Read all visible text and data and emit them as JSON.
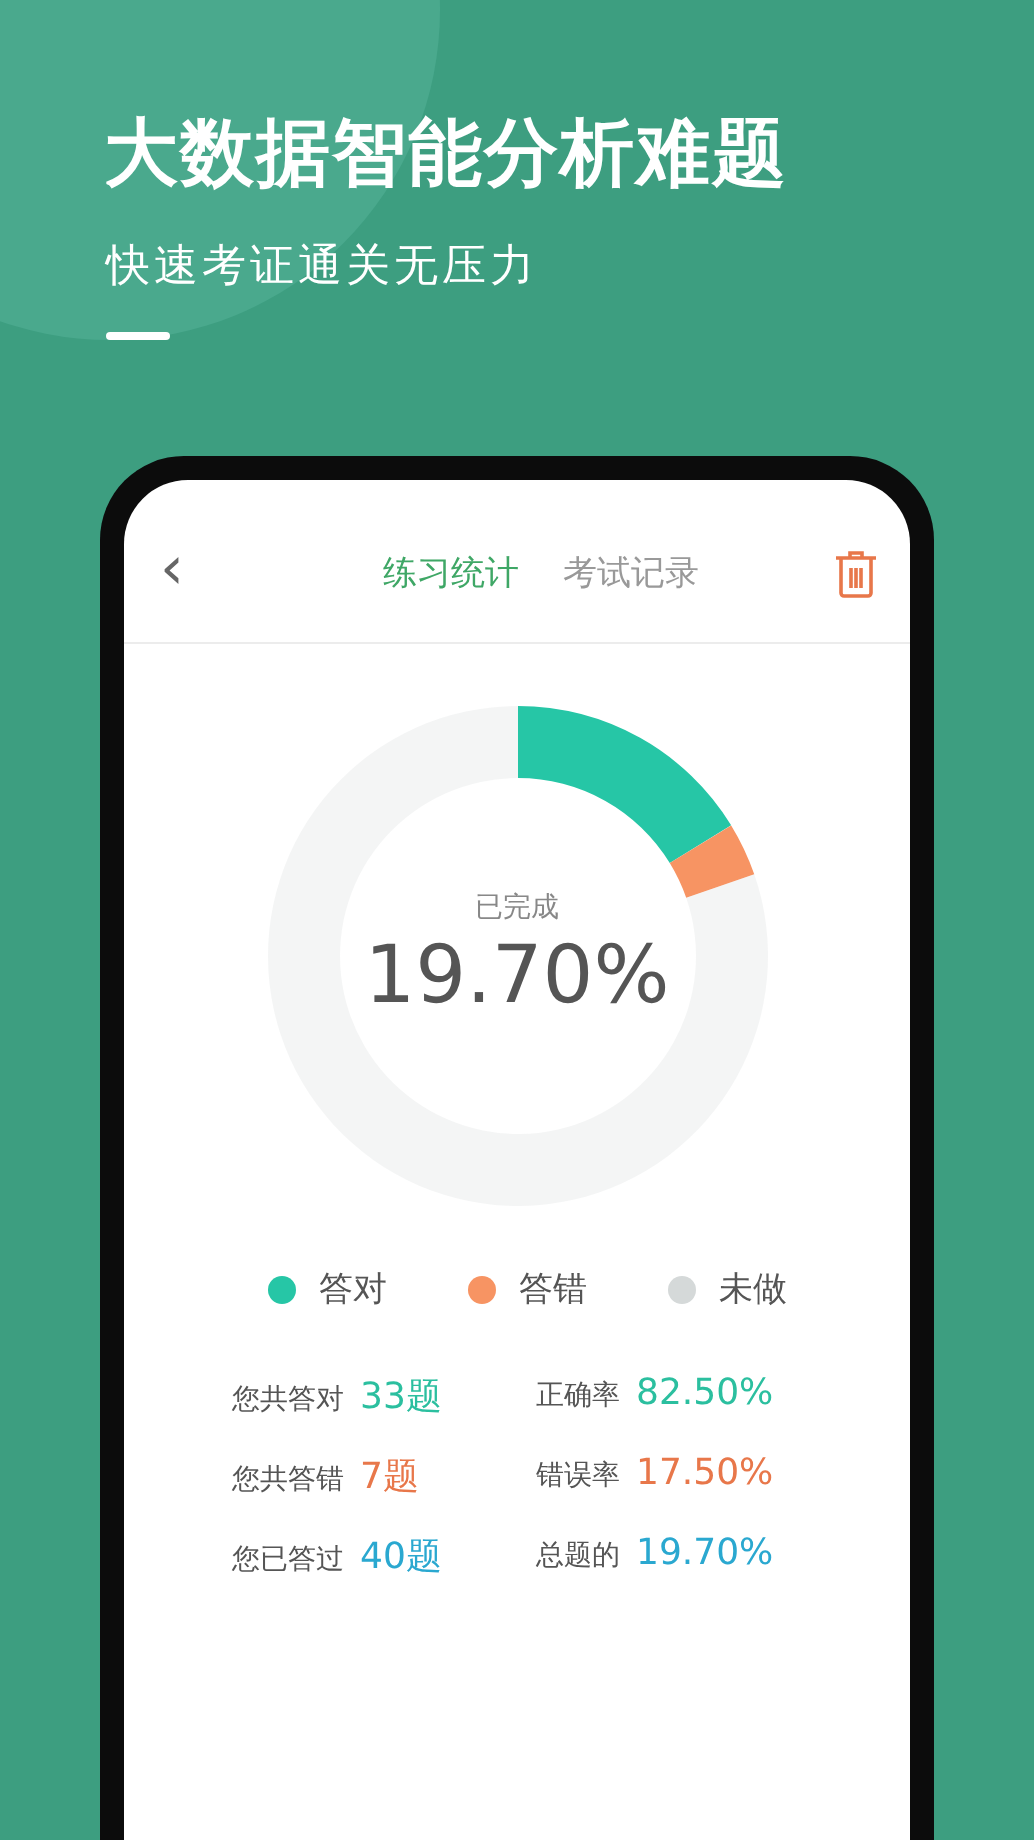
{
  "headline": "大数据智能分析难题",
  "subheadline": "快速考证通关无压力",
  "app_bar": {
    "back": "‹",
    "tabs": [
      {
        "label": "练习统计",
        "selected": true
      },
      {
        "label": "考试记录",
        "selected": false
      }
    ]
  },
  "progress": {
    "caption": "已完成",
    "value": "19.70%",
    "chart_data": {
      "type": "donut",
      "categories": [
        "答对",
        "答错",
        "未做"
      ],
      "values": [
        16.25,
        3.45,
        80.3
      ]
    }
  },
  "legend": [
    {
      "color": "#26c6a6"
    },
    {
      "color": "#f79463"
    },
    {
      "color": "#d5d9d9"
    }
  ],
  "stats": [
    {
      "label": "您共答对",
      "value": "33题",
      "color": "#2bbf9f"
    },
    {
      "label": "正确率",
      "value": "82.50%",
      "color": "#2bbf9f"
    },
    {
      "label": "您共答错",
      "value": "7题",
      "color": "#e8774a"
    },
    {
      "label": "错误率",
      "value": "17.50%",
      "color": "#e8774a"
    },
    {
      "label": "您已答过",
      "value": "40题",
      "color": "#2aa8d0"
    },
    {
      "label": "总题的",
      "value": "19.70%",
      "color": "#2aa8d0"
    }
  ]
}
